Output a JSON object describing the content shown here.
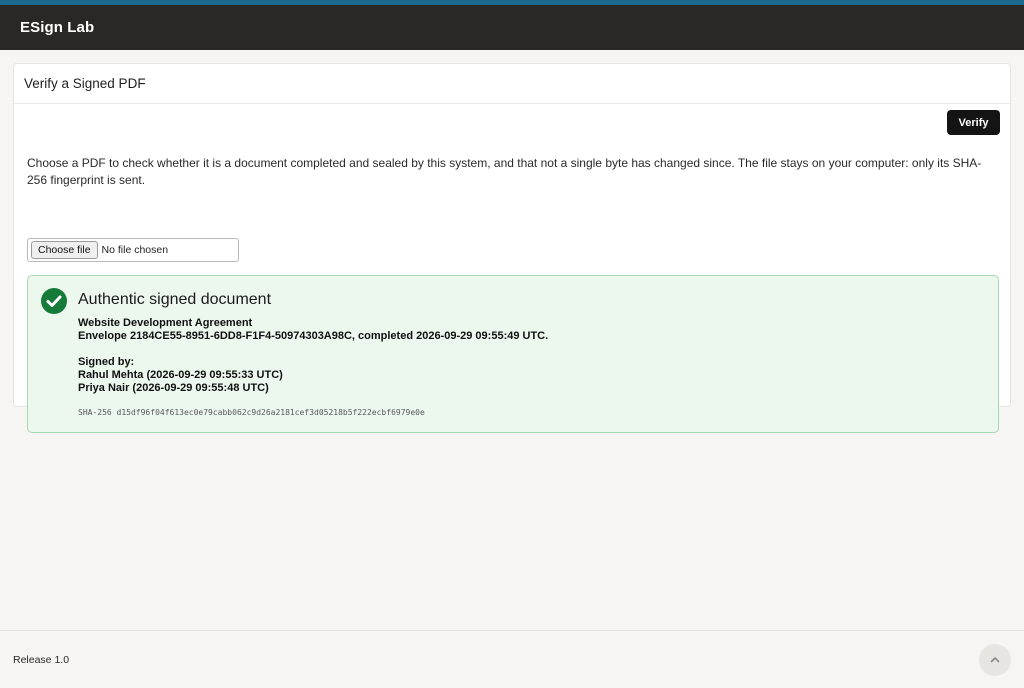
{
  "app": {
    "brand": "ESign Lab",
    "accent_color": "#1c6b8f",
    "header_color": "#2a2825"
  },
  "card": {
    "title": "Verify a Signed PDF",
    "verify_label": "Verify",
    "description": "Choose a PDF to check whether it is a document completed and sealed by this system, and that not a single byte has changed since. The file stays on your computer: only its SHA-256 fingerprint is sent.",
    "file_input": {
      "button_label": "Choose file",
      "status": "No file chosen"
    }
  },
  "result": {
    "status_color": "#167a3a",
    "icon": "check-circle-icon",
    "title": "Authentic signed document",
    "document_name": "Website Development Agreement",
    "envelope_line": "Envelope 2184CE55-8951-6DD8-F1F4-50974303A98C, completed 2026-09-29 09:55:49 UTC.",
    "signed_by_label": "Signed by:",
    "signers": [
      "Rahul Mehta (2026-09-29 09:55:33 UTC)",
      "Priya Nair (2026-09-29 09:55:48 UTC)"
    ],
    "hash_line": "SHA-256 d15df96f04f613ec0e79cabb062c9d26a2181cef3d05218b5f222ecbf6979e0e"
  },
  "footer": {
    "release": "Release 1.0",
    "scroll_top_icon": "chevron-up-icon"
  }
}
